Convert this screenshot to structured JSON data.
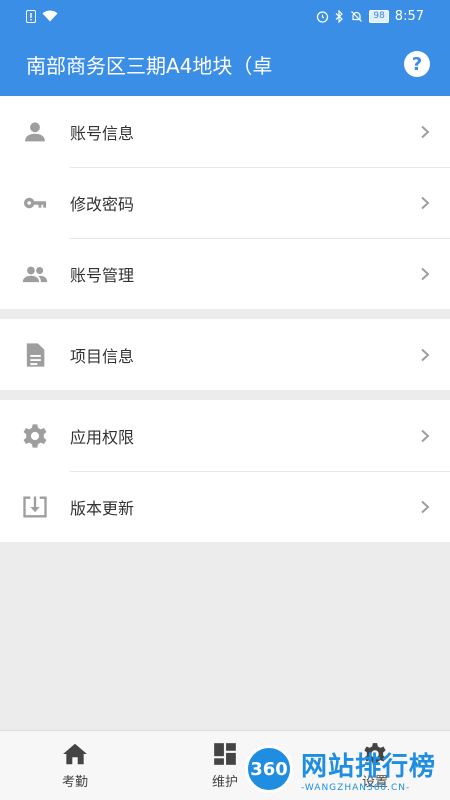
{
  "status_bar": {
    "battery": "98",
    "time": "8:57"
  },
  "app_bar": {
    "title": "南部商务区三期A4地块（卓",
    "help": "?"
  },
  "groups": [
    {
      "items": [
        {
          "label": "账号信息",
          "icon": "person-icon"
        },
        {
          "label": "修改密码",
          "icon": "key-icon"
        },
        {
          "label": "账号管理",
          "icon": "people-icon"
        }
      ]
    },
    {
      "items": [
        {
          "label": "项目信息",
          "icon": "document-icon"
        }
      ]
    },
    {
      "items": [
        {
          "label": "应用权限",
          "icon": "gear-icon"
        },
        {
          "label": "版本更新",
          "icon": "download-icon"
        }
      ]
    }
  ],
  "tab_bar": [
    {
      "label": "考勤",
      "icon": "home-icon"
    },
    {
      "label": "维护",
      "icon": "dashboard-icon"
    },
    {
      "label": "设置",
      "icon": "gear-icon"
    }
  ],
  "watermark": {
    "badge": "360",
    "text_cn": "网站排行榜",
    "text_en": "-WANGZHAN360.CN-"
  },
  "colors": {
    "primary": "#3a8ee6",
    "icon_gray": "#9e9e9e",
    "background": "#ececec"
  }
}
